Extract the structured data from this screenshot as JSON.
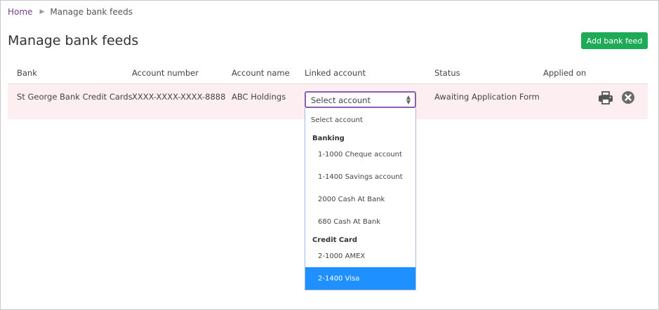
{
  "breadcrumb": {
    "home": "Home",
    "separator": "▶",
    "current": "Manage bank feeds"
  },
  "page_title": "Manage bank feeds",
  "add_button": "Add bank feed",
  "table": {
    "headers": [
      "Bank",
      "Account number",
      "Account name",
      "Linked account",
      "Status",
      "Applied on"
    ],
    "row": {
      "bank": "St George Bank Credit Cards",
      "account_number": "XXXX-XXXX-XXXX-8888",
      "account_name": "ABC Holdings",
      "linked_account": "Select account",
      "status": "Awaiting Application Form",
      "applied_on": ""
    }
  },
  "dropdown": {
    "placeholder": "Select account",
    "groups": [
      {
        "label": "Banking",
        "options": [
          "1-1000 Cheque account",
          "1-1400 Savings account",
          "2000 Cash At Bank",
          "680 Cash At Bank"
        ]
      },
      {
        "label": "Credit Card",
        "options": [
          "2-1000 AMEX",
          "2-1400 Visa"
        ]
      }
    ],
    "highlighted": "2-1400 Visa"
  },
  "icons": {
    "print": "printer-icon",
    "delete": "close-circle-icon"
  },
  "colors": {
    "accent_green": "#1faa58",
    "link_purple": "#7a3e8e",
    "row_highlight": "#fdeef1",
    "select_border": "#8b5fb0",
    "option_selected": "#1e90ff"
  }
}
